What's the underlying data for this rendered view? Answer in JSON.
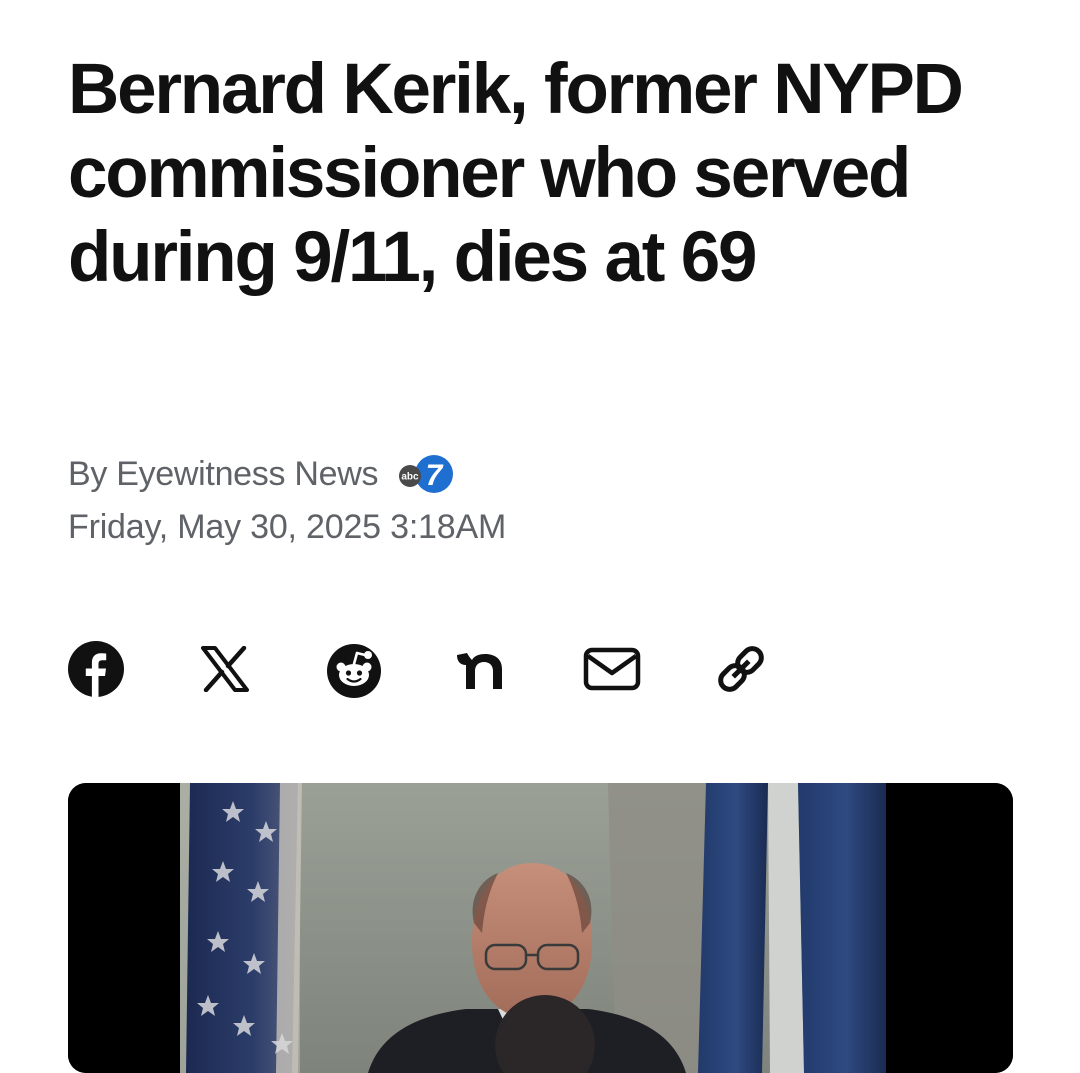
{
  "article": {
    "headline": "Bernard Kerik, former NYPD commissioner who served during 9/11, dies at 69",
    "byline": "By Eyewitness News",
    "source_logo": {
      "text": "abc",
      "number": "7"
    },
    "date": "Friday, May 30, 2025 3:18AM"
  },
  "share": {
    "buttons": [
      {
        "name": "facebook",
        "icon": "facebook-icon"
      },
      {
        "name": "x",
        "icon": "x-icon"
      },
      {
        "name": "reddit",
        "icon": "reddit-icon"
      },
      {
        "name": "nextdoor",
        "icon": "nextdoor-icon"
      },
      {
        "name": "email",
        "icon": "email-icon"
      },
      {
        "name": "copy-link",
        "icon": "link-icon"
      }
    ]
  },
  "media": {
    "type": "video-still"
  },
  "colors": {
    "headline": "#111111",
    "meta_text": "#5f6368",
    "icons": "#111111",
    "abc_blue": "#1f6fd1"
  }
}
